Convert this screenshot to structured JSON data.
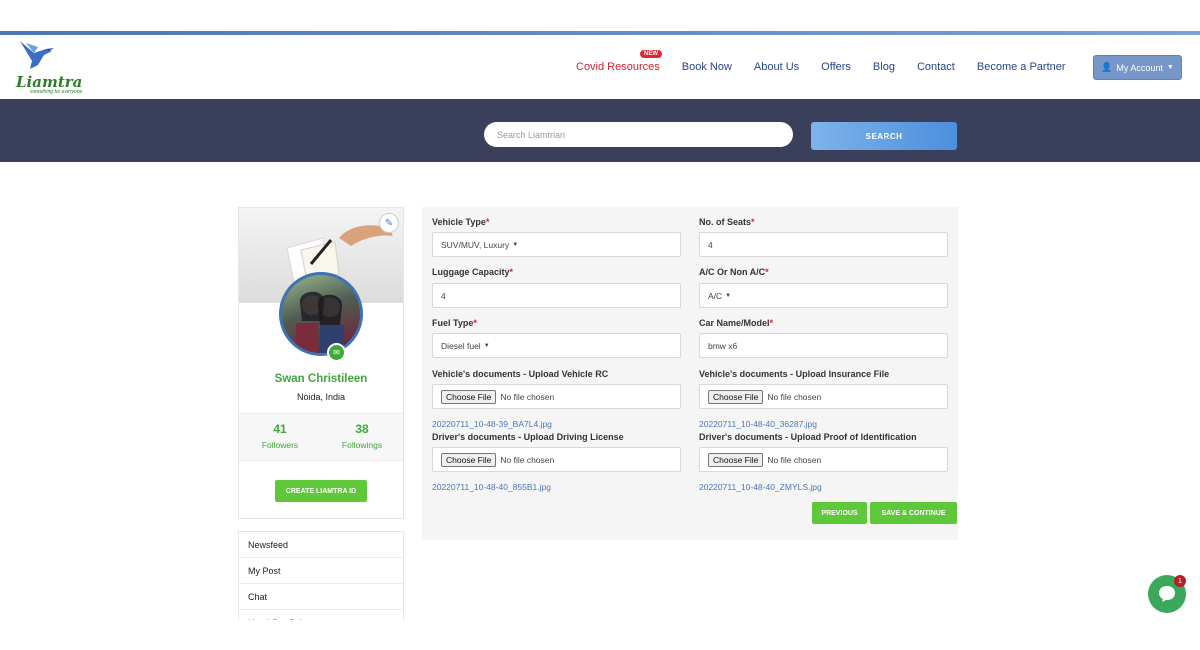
{
  "brand": {
    "name": "Liamtra",
    "tagline": "something for everyone"
  },
  "nav": {
    "items": [
      {
        "label": "Covid Resources",
        "badge": "NEW"
      },
      {
        "label": "Book Now"
      },
      {
        "label": "About Us"
      },
      {
        "label": "Offers"
      },
      {
        "label": "Blog"
      },
      {
        "label": "Contact"
      },
      {
        "label": "Become a Partner"
      }
    ],
    "account_label": "My Account"
  },
  "search": {
    "placeholder": "Search Liamtrian",
    "button_label": "SEARCH"
  },
  "profile": {
    "name": "Swan Christileen",
    "location": "Noida, India",
    "followers_count": "41",
    "followers_label": "Followers",
    "followings_count": "38",
    "followings_label": "Followings",
    "create_button": "CREATE LIAMTRA ID"
  },
  "side_menu": {
    "items": [
      "Newsfeed",
      "My Post",
      "Chat",
      "Used Car Sales"
    ]
  },
  "form": {
    "required_mark": "*",
    "vehicle_type": {
      "label": "Vehicle Type",
      "value": "SUV/MUV, Luxury"
    },
    "seats": {
      "label": "No. of Seats",
      "value": "4"
    },
    "luggage": {
      "label": "Luggage Capacity",
      "value": "4"
    },
    "ac": {
      "label": "A/C Or Non A/C",
      "value": "A/C"
    },
    "fuel": {
      "label": "Fuel Type",
      "value": "Diesel fuel"
    },
    "car_name": {
      "label": "Car Name/Model",
      "value": "bmw x6"
    },
    "choose_file": "Choose File",
    "no_file": "No file chosen",
    "docs": [
      {
        "label": "Vehicle's documents - Upload Vehicle RC",
        "file": "20220711_10-48-39_BA7L4.jpg"
      },
      {
        "label": "Vehicle's documents - Upload Insurance File",
        "file": "20220711_10-48-40_36287.jpg"
      },
      {
        "label": "Driver's documents - Upload Driving License",
        "file": "20220711_10-48-40_855B1.jpg"
      },
      {
        "label": "Driver's documents - Upload Proof of Identification",
        "file": "20220711_10-48-40_ZMYLS.jpg"
      }
    ],
    "previous_button": "PREVIOUS",
    "save_button": "SAVE & CONTINUE"
  },
  "chat": {
    "unread": "1"
  },
  "colors": {
    "nav_blue": "#27468c",
    "covid_red": "#d62030",
    "brand_green": "#3fa83a",
    "hero_bg": "#3a3f5c",
    "button_green": "#5fc83a"
  }
}
